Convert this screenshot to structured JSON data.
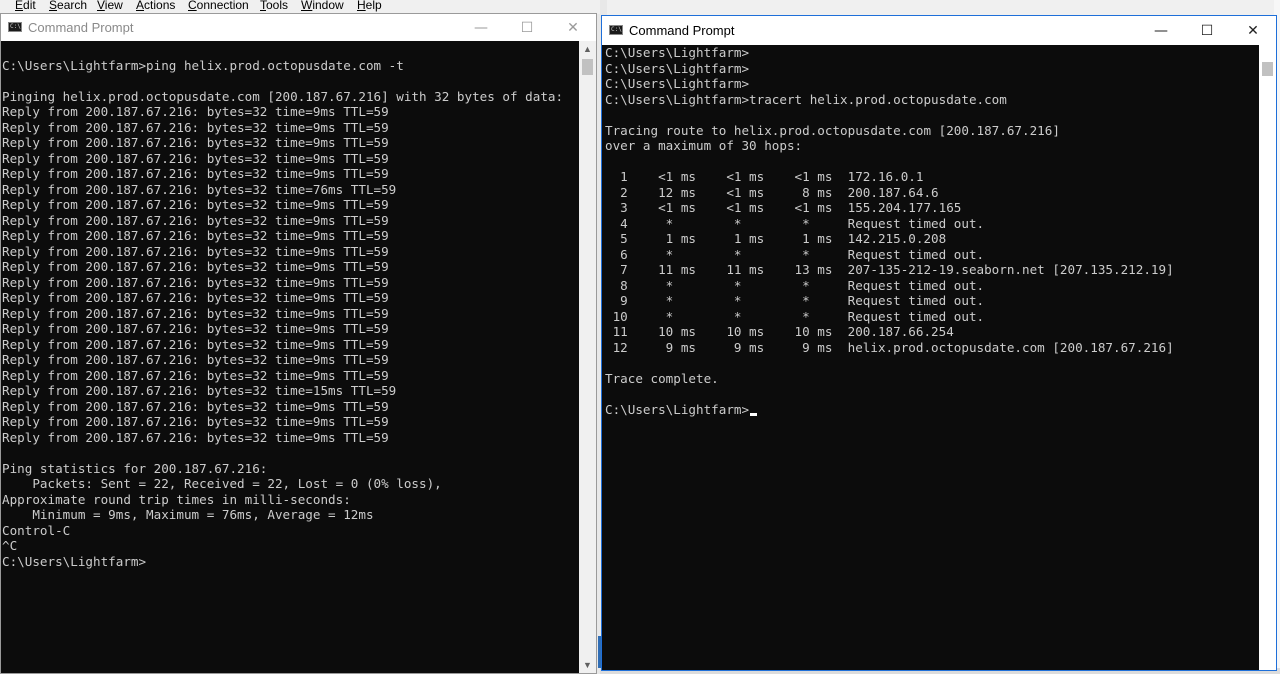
{
  "menubar": {
    "items": [
      "Edit",
      "Search",
      "View",
      "Actions",
      "Connection",
      "Tools",
      "Window",
      "Help"
    ]
  },
  "left_window": {
    "title": "Command Prompt",
    "minimize": "—",
    "maximize": "☐",
    "close": "✕",
    "lines": [
      "",
      "C:\\Users\\Lightfarm>ping helix.prod.octopusdate.com -t",
      "",
      "Pinging helix.prod.octopusdate.com [200.187.67.216] with 32 bytes of data:",
      "Reply from 200.187.67.216: bytes=32 time=9ms TTL=59",
      "Reply from 200.187.67.216: bytes=32 time=9ms TTL=59",
      "Reply from 200.187.67.216: bytes=32 time=9ms TTL=59",
      "Reply from 200.187.67.216: bytes=32 time=9ms TTL=59",
      "Reply from 200.187.67.216: bytes=32 time=9ms TTL=59",
      "Reply from 200.187.67.216: bytes=32 time=76ms TTL=59",
      "Reply from 200.187.67.216: bytes=32 time=9ms TTL=59",
      "Reply from 200.187.67.216: bytes=32 time=9ms TTL=59",
      "Reply from 200.187.67.216: bytes=32 time=9ms TTL=59",
      "Reply from 200.187.67.216: bytes=32 time=9ms TTL=59",
      "Reply from 200.187.67.216: bytes=32 time=9ms TTL=59",
      "Reply from 200.187.67.216: bytes=32 time=9ms TTL=59",
      "Reply from 200.187.67.216: bytes=32 time=9ms TTL=59",
      "Reply from 200.187.67.216: bytes=32 time=9ms TTL=59",
      "Reply from 200.187.67.216: bytes=32 time=9ms TTL=59",
      "Reply from 200.187.67.216: bytes=32 time=9ms TTL=59",
      "Reply from 200.187.67.216: bytes=32 time=9ms TTL=59",
      "Reply from 200.187.67.216: bytes=32 time=9ms TTL=59",
      "Reply from 200.187.67.216: bytes=32 time=15ms TTL=59",
      "Reply from 200.187.67.216: bytes=32 time=9ms TTL=59",
      "Reply from 200.187.67.216: bytes=32 time=9ms TTL=59",
      "Reply from 200.187.67.216: bytes=32 time=9ms TTL=59",
      "",
      "Ping statistics for 200.187.67.216:",
      "    Packets: Sent = 22, Received = 22, Lost = 0 (0% loss),",
      "Approximate round trip times in milli-seconds:",
      "    Minimum = 9ms, Maximum = 76ms, Average = 12ms",
      "Control-C",
      "^C",
      "C:\\Users\\Lightfarm>"
    ]
  },
  "right_window": {
    "title": "Command Prompt",
    "minimize": "—",
    "maximize": "☐",
    "close": "✕",
    "lines": [
      "C:\\Users\\Lightfarm>",
      "C:\\Users\\Lightfarm>",
      "C:\\Users\\Lightfarm>",
      "C:\\Users\\Lightfarm>tracert helix.prod.octopusdate.com",
      "",
      "Tracing route to helix.prod.octopusdate.com [200.187.67.216]",
      "over a maximum of 30 hops:",
      "",
      "  1    <1 ms    <1 ms    <1 ms  172.16.0.1",
      "  2    12 ms    <1 ms     8 ms  200.187.64.6",
      "  3    <1 ms    <1 ms    <1 ms  155.204.177.165",
      "  4     *        *        *     Request timed out.",
      "  5     1 ms     1 ms     1 ms  142.215.0.208",
      "  6     *        *        *     Request timed out.",
      "  7    11 ms    11 ms    13 ms  207-135-212-19.seaborn.net [207.135.212.19]",
      "  8     *        *        *     Request timed out.",
      "  9     *        *        *     Request timed out.",
      " 10     *        *        *     Request timed out.",
      " 11    10 ms    10 ms    10 ms  200.187.66.254",
      " 12     9 ms     9 ms     9 ms  helix.prod.octopusdate.com [200.187.67.216]",
      "",
      "Trace complete.",
      "",
      "C:\\Users\\Lightfarm>"
    ]
  }
}
